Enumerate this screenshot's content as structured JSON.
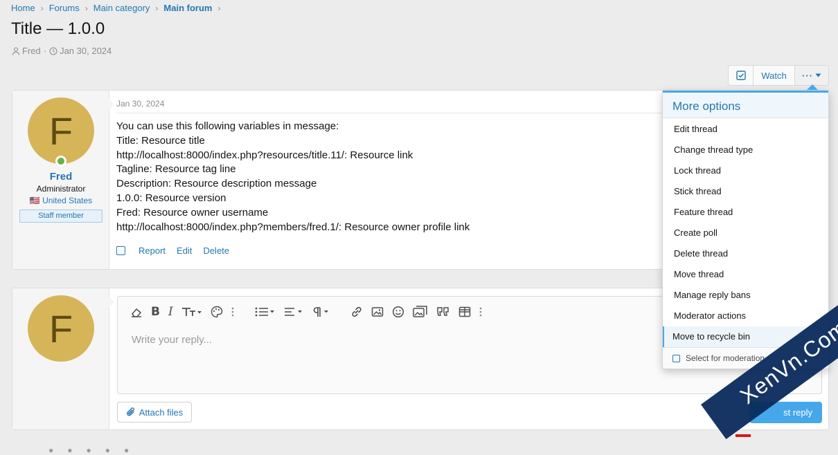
{
  "breadcrumb": [
    {
      "label": "Home"
    },
    {
      "label": "Forums"
    },
    {
      "label": "Main category"
    },
    {
      "label": "Main forum",
      "current": true
    }
  ],
  "thread": {
    "title": "Title — 1.0.0",
    "author": "Fred",
    "date": "Jan 30, 2024"
  },
  "actions": {
    "watch_label": "Watch",
    "more_label": "···"
  },
  "post": {
    "date": "Jan 30, 2024",
    "user": {
      "avatar_letter": "F",
      "name": "Fred",
      "role": "Administrator",
      "location_flag": "🇺🇸",
      "location": "United States",
      "badge": "Staff member"
    },
    "lines": [
      "You can use this following variables in message:",
      "Title: Resource title",
      "http://localhost:8000/index.php?resources/title.11/: Resource link",
      "Tagline: Resource tag line",
      "Description: Resource description message",
      "1.0.0: Resource version",
      "Fred: Resource owner username",
      "http://localhost:8000/index.php?members/fred.1/: Resource owner profile link"
    ],
    "actions": [
      "Report",
      "Edit",
      "Delete"
    ]
  },
  "reply": {
    "avatar_letter": "F",
    "placeholder": "Write your reply...",
    "attach_label": "Attach files",
    "post_reply_label": "st reply"
  },
  "more_menu": {
    "title": "More options",
    "items": [
      "Edit thread",
      "Change thread type",
      "Lock thread",
      "Stick thread",
      "Feature thread",
      "Create poll",
      "Delete thread",
      "Move thread",
      "Manage reply bans",
      "Moderator actions",
      "Move to recycle bin"
    ],
    "active_item": "Move to recycle bin",
    "footer_label": "Select for moderation"
  },
  "watermark": {
    "text": "XenVn.Com"
  },
  "colors": {
    "accent": "#2577b1",
    "button_primary": "#47a7eb",
    "avatar_bg": "#d6b559",
    "online": "#63b545",
    "watermark_bg": "#0a2a5c"
  }
}
